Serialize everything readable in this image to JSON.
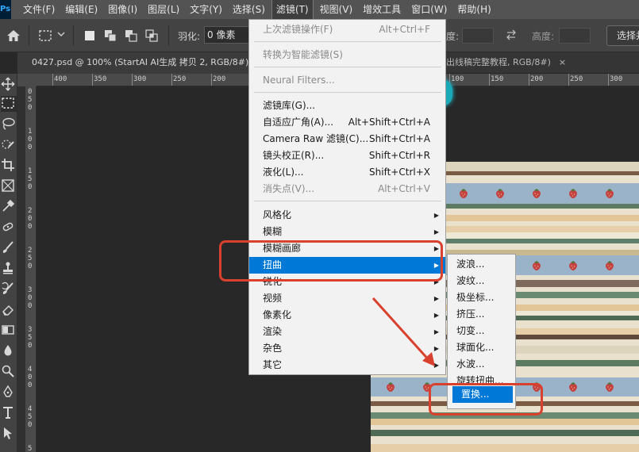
{
  "menubar": {
    "logo": "Ps",
    "items": [
      "文件(F)",
      "编辑(E)",
      "图像(I)",
      "图层(L)",
      "文字(Y)",
      "选择(S)",
      "滤镜(T)",
      "视图(V)",
      "增效工具",
      "窗口(W)",
      "帮助(H)"
    ],
    "active_index": 6
  },
  "options_bar": {
    "feather_label": "羽化:",
    "feather_value": "0 像素",
    "width_label": "度:",
    "height_label": "高度:",
    "select_button": "选择并"
  },
  "tabs": {
    "doc1": "0427.psd @ 100% (StartAI AI生成 拷贝 2, RGB/8#) *",
    "doc2": "出线稿完整教程, RGB/8#)",
    "close_symbol": "×"
  },
  "ruler": {
    "top_marks": [
      "400",
      "350",
      "300",
      "250",
      "200",
      "150",
      "100",
      "50",
      "0",
      "50",
      "100",
      "150",
      "200",
      "250",
      "300",
      "350",
      "400"
    ],
    "left_marks": [
      "0",
      "5",
      "0",
      "1",
      "0",
      "0",
      "1",
      "5",
      "0",
      "2",
      "0",
      "0",
      "2",
      "5",
      "0",
      "3",
      "0",
      "0",
      "3",
      "5",
      "0",
      "4",
      "0",
      "0",
      "4",
      "5",
      "0",
      "5",
      "0",
      "0"
    ]
  },
  "filter_menu": {
    "items": [
      {
        "label": "上次滤镜操作(F)",
        "shortcut": "Alt+Ctrl+F",
        "disabled": true
      },
      {
        "label": "转换为智能滤镜(S)",
        "shortcut": "",
        "disabled": true
      },
      {
        "label": "Neural Filters...",
        "shortcut": "",
        "disabled": true
      },
      {
        "label": "滤镜库(G)...",
        "shortcut": "",
        "disabled": false
      },
      {
        "label": "自适应广角(A)...",
        "shortcut": "Alt+Shift+Ctrl+A",
        "disabled": false
      },
      {
        "label": "Camera Raw 滤镜(C)...",
        "shortcut": "Shift+Ctrl+A",
        "disabled": false
      },
      {
        "label": "镜头校正(R)...",
        "shortcut": "Shift+Ctrl+R",
        "disabled": false
      },
      {
        "label": "液化(L)...",
        "shortcut": "Shift+Ctrl+X",
        "disabled": false
      },
      {
        "label": "消失点(V)...",
        "shortcut": "Alt+Ctrl+V",
        "disabled": true
      },
      {
        "label": "风格化",
        "submenu": true
      },
      {
        "label": "模糊",
        "submenu": true
      },
      {
        "label": "模糊画廊",
        "submenu": true
      },
      {
        "label": "扭曲",
        "submenu": true,
        "highlighted": true
      },
      {
        "label": "锐化",
        "submenu": true
      },
      {
        "label": "视频",
        "submenu": true
      },
      {
        "label": "像素化",
        "submenu": true
      },
      {
        "label": "渲染",
        "submenu": true
      },
      {
        "label": "杂色",
        "submenu": true
      },
      {
        "label": "其它",
        "submenu": true
      }
    ]
  },
  "distort_submenu": {
    "items": [
      "波浪...",
      "波纹...",
      "极坐标...",
      "挤压...",
      "切变...",
      "球面化...",
      "水波...",
      "旋转扭曲...",
      "置换..."
    ],
    "highlighted_index": 8
  },
  "colors": {
    "menu_highlight": "#0078d7",
    "annotation_red": "#d9412f",
    "ui_dark": "#282828"
  }
}
